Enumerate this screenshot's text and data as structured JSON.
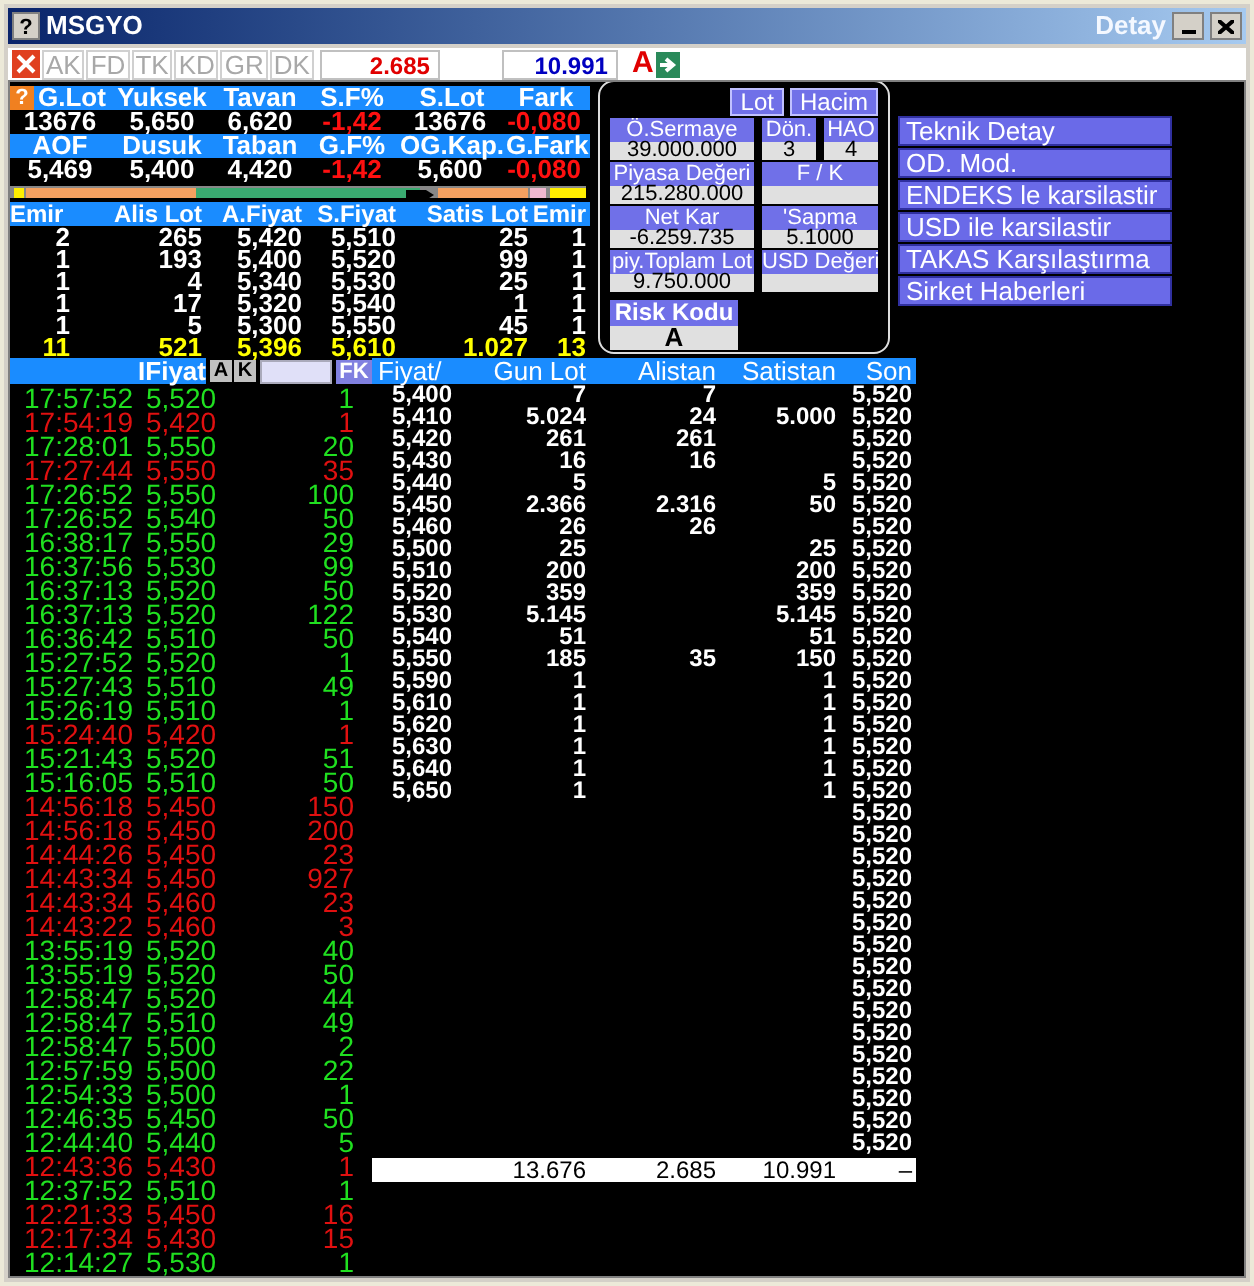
{
  "window": {
    "help": "?",
    "title": "MSGYO",
    "subtitle": "Detay"
  },
  "toolbar": {
    "tabs": [
      {
        "label": "AK",
        "disabled": true
      },
      {
        "label": "FD",
        "disabled": true
      },
      {
        "label": "TK",
        "disabled": true
      },
      {
        "label": "KD",
        "disabled": true
      },
      {
        "label": "GR",
        "disabled": true
      },
      {
        "label": "DK",
        "disabled": true
      }
    ],
    "buy_total": "2.685",
    "sell_total": "10.991",
    "flag": "A"
  },
  "summary": {
    "help": "?",
    "blocks": [
      {
        "headers": [
          "G.Lot",
          "Yuksek",
          "Tavan",
          "S.F%",
          "S.Lot",
          "Fark"
        ],
        "values": [
          {
            "text": "13676",
            "negative": false
          },
          {
            "text": "5,650",
            "negative": false
          },
          {
            "text": "6,620",
            "negative": false
          },
          {
            "text": "-1,42",
            "negative": true
          },
          {
            "text": "13676",
            "negative": false
          },
          {
            "text": "-0,080",
            "negative": true
          }
        ]
      },
      {
        "headers": [
          "AOF",
          "Dusuk",
          "Taban",
          "G.F%",
          "OG.Kap.",
          "G.Fark"
        ],
        "values": [
          {
            "text": "5,469",
            "negative": false
          },
          {
            "text": "5,400",
            "negative": false
          },
          {
            "text": "4,420",
            "negative": false
          },
          {
            "text": "-1,42",
            "negative": true
          },
          {
            "text": "5,600",
            "negative": false
          },
          {
            "text": "-0,080",
            "negative": true
          }
        ]
      }
    ]
  },
  "order_book": {
    "columns": [
      "Emir",
      "Alis Lot",
      "A.Fiyat",
      "S.Fiyat",
      "Satis Lot",
      "Emir"
    ],
    "rows": [
      [
        "2",
        "265",
        "5,420",
        "5,510",
        "25",
        "1"
      ],
      [
        "1",
        "193",
        "5,400",
        "5,520",
        "99",
        "1"
      ],
      [
        "1",
        "4",
        "5,340",
        "5,530",
        "25",
        "1"
      ],
      [
        "1",
        "17",
        "5,320",
        "5,540",
        "1",
        "1"
      ],
      [
        "1",
        "5",
        "5,300",
        "5,550",
        "45",
        "1"
      ]
    ],
    "totals": [
      "11",
      "521",
      "5,396",
      "5,610",
      "1.027",
      "13"
    ]
  },
  "company_panel": {
    "toggles": [
      "Lot",
      "Hacim"
    ],
    "field_rows": [
      [
        {
          "label": "Ö.Sermaye",
          "value": "39.000.000"
        },
        {
          "label": "Dön.",
          "value": "3"
        },
        {
          "label": "HAO",
          "value": "4"
        }
      ],
      [
        {
          "label": "Piyasa Değeri",
          "value": "215.280.000"
        },
        {
          "label": "F / K"
        }
      ],
      [
        {
          "label": "Net Kar",
          "value": "-6.259.735"
        },
        {
          "label": "'Sapma",
          "value": "5.1000"
        }
      ],
      [
        {
          "label": "piy.Toplam Lot",
          "value": "9.750.000"
        },
        {
          "label": "USD Değeri"
        }
      ]
    ],
    "risk": {
      "label": "Risk Kodu",
      "value": "A"
    }
  },
  "actions": [
    "Teknik Detay",
    "OD. Mod.",
    "ENDEKS le karsilastir",
    "USD ile karsilastir",
    "TAKAS Karşılaştırma",
    "Sirket Haberleri"
  ],
  "trades": {
    "header": "IFiyat",
    "buttons": [
      "A",
      "K"
    ],
    "filter_button": "FK",
    "rows": [
      {
        "time": "17:57:52",
        "price": "5,520",
        "lot": "1",
        "sell": false
      },
      {
        "time": "17:54:19",
        "price": "5,420",
        "lot": "1",
        "sell": true
      },
      {
        "time": "17:28:01",
        "price": "5,550",
        "lot": "20",
        "sell": false
      },
      {
        "time": "17:27:44",
        "price": "5,550",
        "lot": "35",
        "sell": true
      },
      {
        "time": "17:26:52",
        "price": "5,550",
        "lot": "100",
        "sell": false
      },
      {
        "time": "17:26:52",
        "price": "5,540",
        "lot": "50",
        "sell": false
      },
      {
        "time": "16:38:17",
        "price": "5,550",
        "lot": "29",
        "sell": false
      },
      {
        "time": "16:37:56",
        "price": "5,530",
        "lot": "99",
        "sell": false
      },
      {
        "time": "16:37:13",
        "price": "5,520",
        "lot": "50",
        "sell": false
      },
      {
        "time": "16:37:13",
        "price": "5,520",
        "lot": "122",
        "sell": false
      },
      {
        "time": "16:36:42",
        "price": "5,510",
        "lot": "50",
        "sell": false
      },
      {
        "time": "15:27:52",
        "price": "5,520",
        "lot": "1",
        "sell": false
      },
      {
        "time": "15:27:43",
        "price": "5,510",
        "lot": "49",
        "sell": false
      },
      {
        "time": "15:26:19",
        "price": "5,510",
        "lot": "1",
        "sell": false
      },
      {
        "time": "15:24:40",
        "price": "5,420",
        "lot": "1",
        "sell": true
      },
      {
        "time": "15:21:43",
        "price": "5,520",
        "lot": "51",
        "sell": false
      },
      {
        "time": "15:16:05",
        "price": "5,510",
        "lot": "50",
        "sell": false
      },
      {
        "time": "14:56:18",
        "price": "5,450",
        "lot": "150",
        "sell": true
      },
      {
        "time": "14:56:18",
        "price": "5,450",
        "lot": "200",
        "sell": true
      },
      {
        "time": "14:44:26",
        "price": "5,450",
        "lot": "23",
        "sell": true
      },
      {
        "time": "14:43:34",
        "price": "5,450",
        "lot": "927",
        "sell": true
      },
      {
        "time": "14:43:34",
        "price": "5,460",
        "lot": "23",
        "sell": true
      },
      {
        "time": "14:43:22",
        "price": "5,460",
        "lot": "3",
        "sell": true
      },
      {
        "time": "13:55:19",
        "price": "5,520",
        "lot": "40",
        "sell": false
      },
      {
        "time": "13:55:19",
        "price": "5,520",
        "lot": "50",
        "sell": false
      },
      {
        "time": "12:58:47",
        "price": "5,520",
        "lot": "44",
        "sell": false
      },
      {
        "time": "12:58:47",
        "price": "5,510",
        "lot": "49",
        "sell": false
      },
      {
        "time": "12:58:47",
        "price": "5,500",
        "lot": "2",
        "sell": false
      },
      {
        "time": "12:57:59",
        "price": "5,500",
        "lot": "22",
        "sell": false
      },
      {
        "time": "12:54:33",
        "price": "5,500",
        "lot": "1",
        "sell": false
      },
      {
        "time": "12:46:35",
        "price": "5,450",
        "lot": "50",
        "sell": false
      },
      {
        "time": "12:44:40",
        "price": "5,440",
        "lot": "5",
        "sell": false
      },
      {
        "time": "12:43:36",
        "price": "5,430",
        "lot": "1",
        "sell": true
      },
      {
        "time": "12:37:52",
        "price": "5,510",
        "lot": "1",
        "sell": false
      },
      {
        "time": "12:21:33",
        "price": "5,450",
        "lot": "16",
        "sell": true
      },
      {
        "time": "12:17:34",
        "price": "5,430",
        "lot": "15",
        "sell": true
      },
      {
        "time": "12:14:27",
        "price": "5,530",
        "lot": "1",
        "sell": false
      }
    ]
  },
  "price_table": {
    "columns": [
      "Fiyat/",
      "Gun Lot",
      "Alistan",
      "Satistan",
      "Son"
    ],
    "rows": [
      {
        "price": "5,400",
        "gun_lot": "7",
        "alistan": "7",
        "son": "5,520"
      },
      {
        "price": "5,410",
        "gun_lot": "5.024",
        "alistan": "24",
        "satistan": "5.000",
        "son": "5,520"
      },
      {
        "price": "5,420",
        "gun_lot": "261",
        "alistan": "261",
        "son": "5,520"
      },
      {
        "price": "5,430",
        "gun_lot": "16",
        "alistan": "16",
        "son": "5,520"
      },
      {
        "price": "5,440",
        "gun_lot": "5",
        "satistan": "5",
        "son": "5,520"
      },
      {
        "price": "5,450",
        "gun_lot": "2.366",
        "alistan": "2.316",
        "satistan": "50",
        "son": "5,520"
      },
      {
        "price": "5,460",
        "gun_lot": "26",
        "alistan": "26",
        "son": "5,520"
      },
      {
        "price": "5,500",
        "gun_lot": "25",
        "satistan": "25",
        "son": "5,520"
      },
      {
        "price": "5,510",
        "gun_lot": "200",
        "satistan": "200",
        "son": "5,520"
      },
      {
        "price": "5,520",
        "gun_lot": "359",
        "satistan": "359",
        "son": "5,520"
      },
      {
        "price": "5,530",
        "gun_lot": "5.145",
        "satistan": "5.145",
        "son": "5,520"
      },
      {
        "price": "5,540",
        "gun_lot": "51",
        "satistan": "51",
        "son": "5,520"
      },
      {
        "price": "5,550",
        "gun_lot": "185",
        "alistan": "35",
        "satistan": "150",
        "son": "5,520"
      },
      {
        "price": "5,590",
        "gun_lot": "1",
        "satistan": "1",
        "son": "5,520"
      },
      {
        "price": "5,610",
        "gun_lot": "1",
        "satistan": "1",
        "son": "5,520"
      },
      {
        "price": "5,620",
        "gun_lot": "1",
        "satistan": "1",
        "son": "5,520"
      },
      {
        "price": "5,630",
        "gun_lot": "1",
        "satistan": "1",
        "son": "5,520"
      },
      {
        "price": "5,640",
        "gun_lot": "1",
        "satistan": "1",
        "son": "5,520"
      },
      {
        "price": "5,650",
        "gun_lot": "1",
        "satistan": "1",
        "son": "5,520"
      },
      {
        "son": "5,520"
      },
      {
        "son": "5,520"
      },
      {
        "son": "5,520"
      },
      {
        "son": "5,520"
      },
      {
        "son": "5,520"
      },
      {
        "son": "5,520"
      },
      {
        "son": "5,520"
      },
      {
        "son": "5,520"
      },
      {
        "son": "5,520"
      },
      {
        "son": "5,520"
      },
      {
        "son": "5,520"
      },
      {
        "son": "5,520"
      },
      {
        "son": "5,520"
      },
      {
        "son": "5,520"
      },
      {
        "son": "5,520"
      },
      {
        "son": "5,520"
      }
    ],
    "totals": {
      "gun_lot": "13.676",
      "alistan": "2.685",
      "satistan": "10.991",
      "son": "–"
    }
  }
}
